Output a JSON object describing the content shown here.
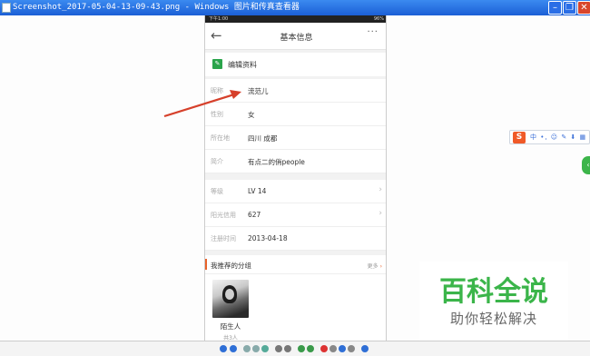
{
  "window": {
    "title": "Screenshot_2017-05-04-13-09-43.png - Windows 图片和传真查看器"
  },
  "status_bar": {
    "time": "下午1:00",
    "battery": "96%"
  },
  "nav": {
    "back_glyph": "←",
    "title": "基本信息",
    "more_glyph": "···"
  },
  "edit": {
    "icon_glyph": "✎",
    "label": "编辑资料",
    "chevron": "›"
  },
  "info_rows": [
    {
      "label": "昵称",
      "value": "流范儿"
    },
    {
      "label": "性别",
      "value": "女"
    },
    {
      "label": "所在地",
      "value": "四川 成都"
    },
    {
      "label": "简介",
      "value": "有点二的俏people"
    }
  ],
  "level_rows": [
    {
      "label": "等级",
      "value": "LV 14",
      "chevron": "›"
    },
    {
      "label": "阳光信用",
      "value": "627",
      "chevron": "›"
    },
    {
      "label": "注册时间",
      "value": "2013-04-18"
    }
  ],
  "recommend": {
    "title": "我推荐的分组",
    "more": "更多",
    "more_glyph": "›",
    "group": {
      "name": "陌生人",
      "sub": "共3人"
    }
  },
  "sogou": {
    "logo": "S",
    "items": "中 •, ☺ ✎ ⬇ ▦"
  },
  "side_button": {
    "glyph": "‹"
  },
  "watermark": {
    "title": "百科全说",
    "subtitle": "助你轻松解决"
  },
  "colors": {
    "titlebar": "#1b5fd6",
    "accent_orange": "#e8622a",
    "accent_green": "#3cb54a",
    "arrow": "#d6402b"
  }
}
